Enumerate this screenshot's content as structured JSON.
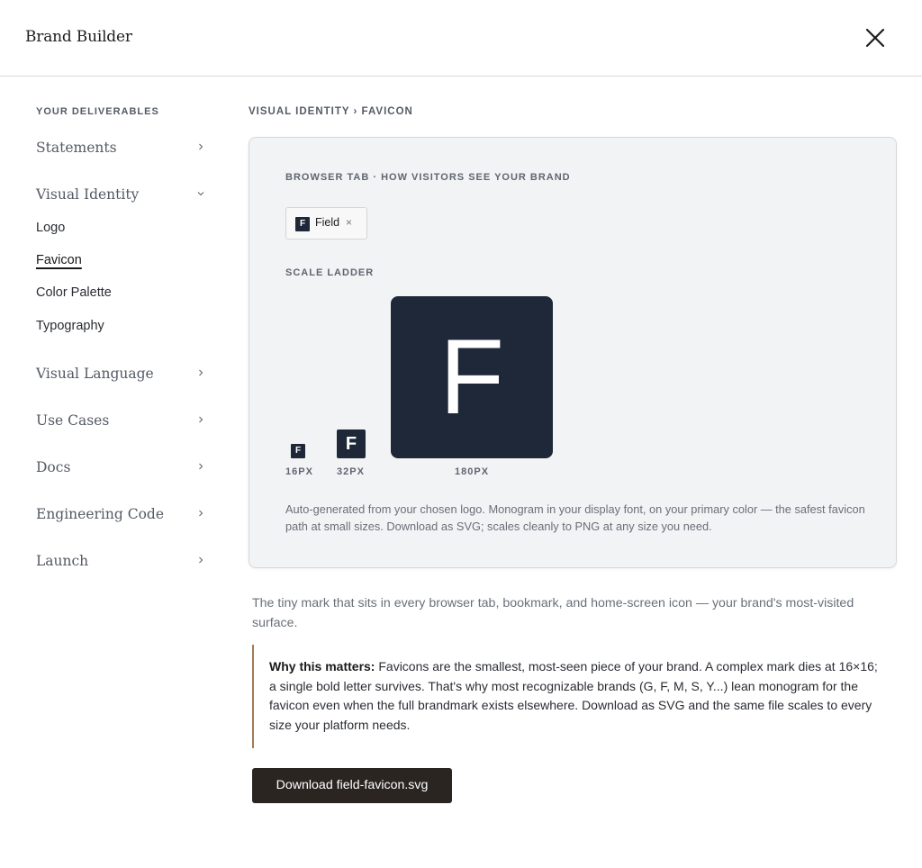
{
  "app": {
    "title": "Brand Builder"
  },
  "sidebar": {
    "heading": "YOUR DELIVERABLES",
    "sections": {
      "statements": {
        "label": "Statements",
        "icon": "chevron-right-icon"
      },
      "visual_identity": {
        "label": "Visual Identity",
        "icon": "chevron-down-icon",
        "items": {
          "logo": "Logo",
          "favicon": "Favicon",
          "color_palette": "Color Palette",
          "typography": "Typography"
        }
      },
      "visual_language": {
        "label": "Visual Language",
        "icon": "chevron-right-icon"
      },
      "use_cases": {
        "label": "Use Cases",
        "icon": "chevron-right-icon"
      },
      "docs": {
        "label": "Docs",
        "icon": "chevron-right-icon"
      },
      "engineering_code": {
        "label": "Engineering Code",
        "icon": "chevron-right-icon"
      },
      "launch": {
        "label": "Launch",
        "icon": "chevron-right-icon"
      }
    },
    "active_item": "Favicon"
  },
  "breadcrumb": "VISUAL IDENTITY › FAVICON",
  "card": {
    "browser_tab_label": "BROWSER TAB · HOW VISITORS SEE YOUR BRAND",
    "tab": {
      "icon_letter": "F",
      "name": "Field",
      "close": "×"
    },
    "scale_label": "SCALE LADDER",
    "ladder": {
      "letter": "F",
      "size16": "16PX",
      "size32": "32PX",
      "size180": "180PX"
    },
    "note": "Auto-generated from your chosen logo. Monogram in your display font, on your primary color — the safest favicon path at small sizes. Download as SVG; scales cleanly to PNG at any size you need."
  },
  "intro": "The tiny mark that sits in every browser tab, bookmark, and home-screen icon — your brand's most-visited surface.",
  "callout": {
    "lead": "Why this matters:",
    "body": " Favicons are the smallest, most-seen piece of your brand. A complex mark dies at 16×16; a single bold letter survives. That's why most recognizable brands (G, F, M, S, Y...) lean monogram for the favicon even when the full brandmark exists elsewhere. Download as SVG and the same file scales to every size your platform needs."
  },
  "download_button": "Download field-favicon.svg",
  "colors": {
    "favicon_bg": "#1f2838",
    "favicon_fg": "#ffffff",
    "button_bg": "#2b2522",
    "callout_accent": "#a47a58",
    "card_bg": "#f2f3f5"
  }
}
